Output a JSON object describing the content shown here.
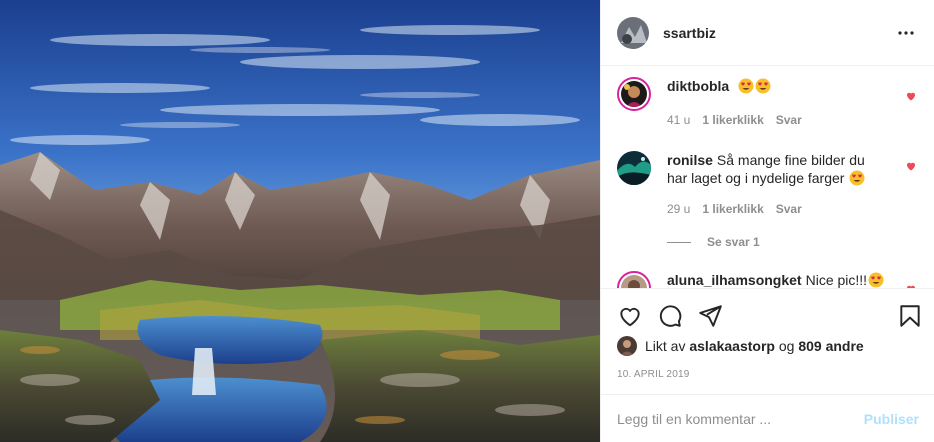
{
  "post": {
    "username": "ssartbiz",
    "image_subject": "mountain-lake-painting"
  },
  "comments": [
    {
      "username": "diktbobla",
      "text": "",
      "emojis": [
        "heart-eyes",
        "heart-eyes"
      ],
      "time": "41 u",
      "likes": "1 likerklikk",
      "reply_label": "Svar",
      "liked": true
    },
    {
      "username": "ronilse",
      "text": "Så mange fine bilder du har laget og i nydelige farger",
      "emojis": [
        "heart-eyes"
      ],
      "time": "29 u",
      "likes": "1 likerklikk",
      "reply_label": "Svar",
      "liked": true
    },
    {
      "username": "aluna_ilhamsongket",
      "text": "Nice pic!!!",
      "emojis": [
        "heart-eyes"
      ],
      "liked": true
    }
  ],
  "see_replies": "Se svar 1",
  "likes": {
    "prefix": "Likt av",
    "user": "aslakaastorp",
    "joiner": "og",
    "others": "809 andre"
  },
  "date": "10. APRIL 2019",
  "composer": {
    "placeholder": "Legg til en kommentar ...",
    "post_label": "Publiser"
  },
  "colors": {
    "liked_heart": "#ed4956",
    "post_button_disabled": "#b2dffc",
    "story_ring": "#d6249f"
  }
}
